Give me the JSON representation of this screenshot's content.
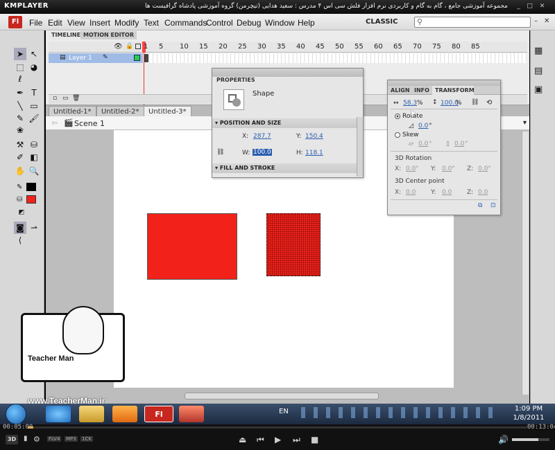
{
  "km": {
    "logo": "KMPLAYER",
    "title": "مجموعه آموزشی جامع ، گام به گام و کاربردی نرم افزار فلش سی اس ۴ مدرس : سعید هدایی (تیچرمن) گروه آموزشی پادشاه گرافیست ها"
  },
  "app": {
    "icon": "Fl",
    "menu": [
      "File",
      "Edit",
      "View",
      "Insert",
      "Modify",
      "Text",
      "Commands",
      "Control",
      "Debug",
      "Window",
      "Help"
    ],
    "workspace": "CLASSIC",
    "search_placeholder": ""
  },
  "timeline": {
    "tabs": [
      "TIMELINE",
      "MOTION EDITOR"
    ],
    "layer": "Layer 1",
    "frames": [
      "1",
      "5",
      "10",
      "15",
      "20",
      "25",
      "30",
      "35",
      "40",
      "45",
      "50",
      "55",
      "60",
      "65",
      "70",
      "75",
      "80",
      "85"
    ]
  },
  "doc_tabs": [
    "Untitled-1*",
    "Untitled-2*",
    "Untitled-3*"
  ],
  "scene": "Scene 1",
  "properties": {
    "title": "PROPERTIES",
    "type": "Shape",
    "sec_pos": "POSITION AND SIZE",
    "x_label": "X:",
    "x": "287.7",
    "y_label": "Y:",
    "y": "150.4",
    "w_label": "W:",
    "w": "100.0",
    "h_label": "H:",
    "h": "118.1",
    "sec_fill": "FILL AND STROKE"
  },
  "transform": {
    "tabs": [
      "ALIGN",
      "INFO",
      "TRANSFORM"
    ],
    "scale_w": "58.3",
    "scale_h": "100.0",
    "pct": "%",
    "rotate": "Rotate",
    "rot_val": "0.0",
    "deg": "°",
    "skew": "Skew",
    "skew_h": "0.0",
    "skew_v": "0.0",
    "rot3d": "3D Rotation",
    "center3d": "3D Center point",
    "x": "X:",
    "y": "Y:",
    "z": "Z:",
    "zero": "0.0"
  },
  "watermark": {
    "url": "www.TeacherMan.ir",
    "label": "Teacher Man"
  },
  "taskbar": {
    "lang": "EN",
    "time": "1:09 PM",
    "date": "1/8/2011"
  },
  "player": {
    "elapsed": "00:05:00",
    "total": "00:13:04",
    "badges": [
      "FLV4",
      "MP3",
      "1CK"
    ],
    "badge3d": "3D"
  },
  "colors": {
    "shape_fill": "#f2221b",
    "accent": "#2a5db0"
  }
}
